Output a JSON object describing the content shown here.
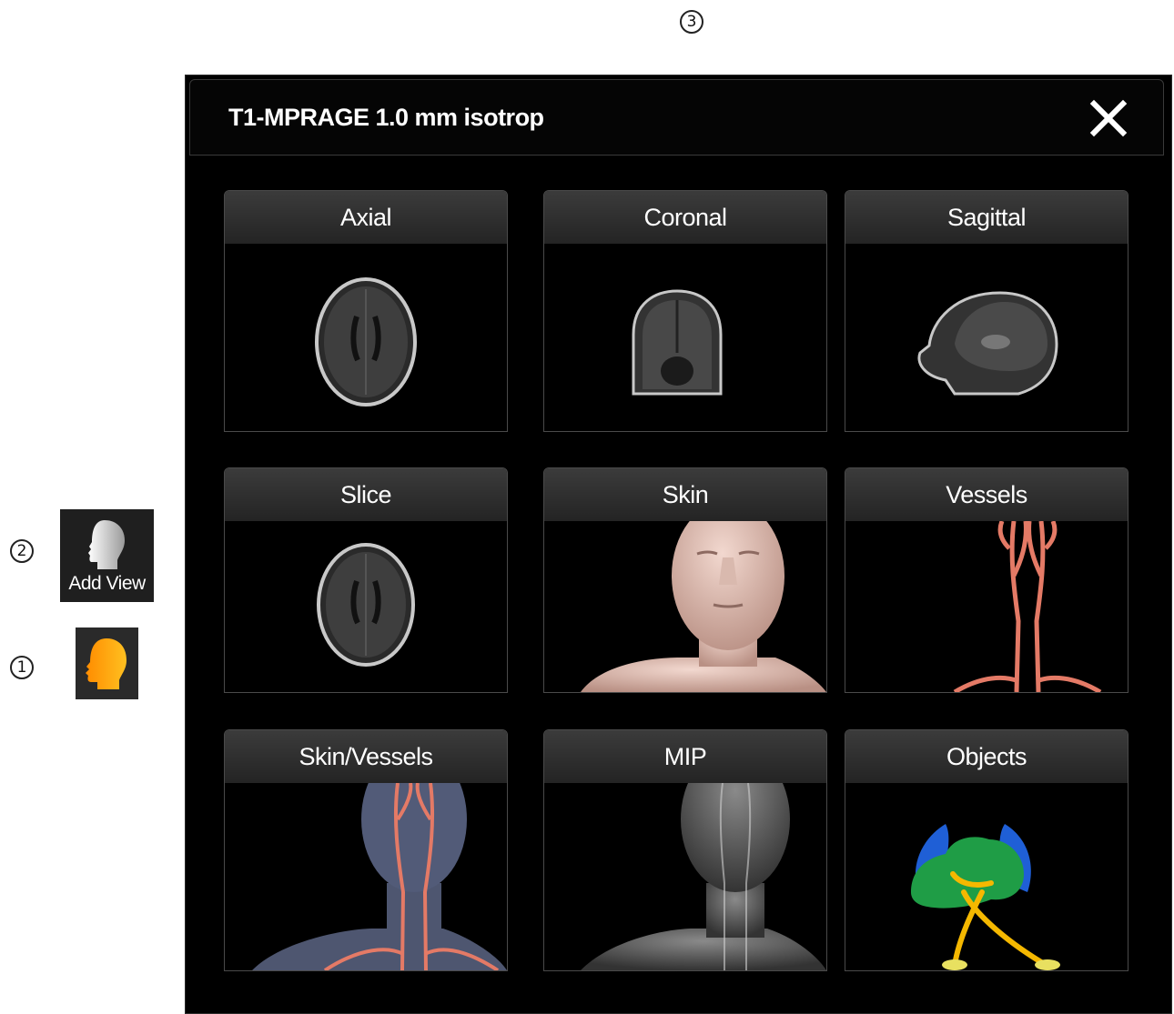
{
  "markers": {
    "one": "1",
    "two": "2",
    "three": "3"
  },
  "side_buttons": {
    "add_view_label": "Add View",
    "add_view_icon": "head-profile-icon",
    "profile_icon": "head-profile-orange-icon"
  },
  "dialog": {
    "title": "T1-MPRAGE 1.0 mm isotrop",
    "close_icon": "close-icon",
    "tiles": [
      {
        "label": "Axial"
      },
      {
        "label": "Coronal"
      },
      {
        "label": "Sagittal"
      },
      {
        "label": "Slice"
      },
      {
        "label": "Skin"
      },
      {
        "label": "Vessels"
      },
      {
        "label": "Skin/Vessels"
      },
      {
        "label": "MIP"
      },
      {
        "label": "Objects"
      }
    ]
  },
  "colors": {
    "panel_bg": "#000000",
    "tile_header": "#2f2f2f",
    "accent_orange": "#f6a300",
    "vessel_red": "#e47a66"
  }
}
